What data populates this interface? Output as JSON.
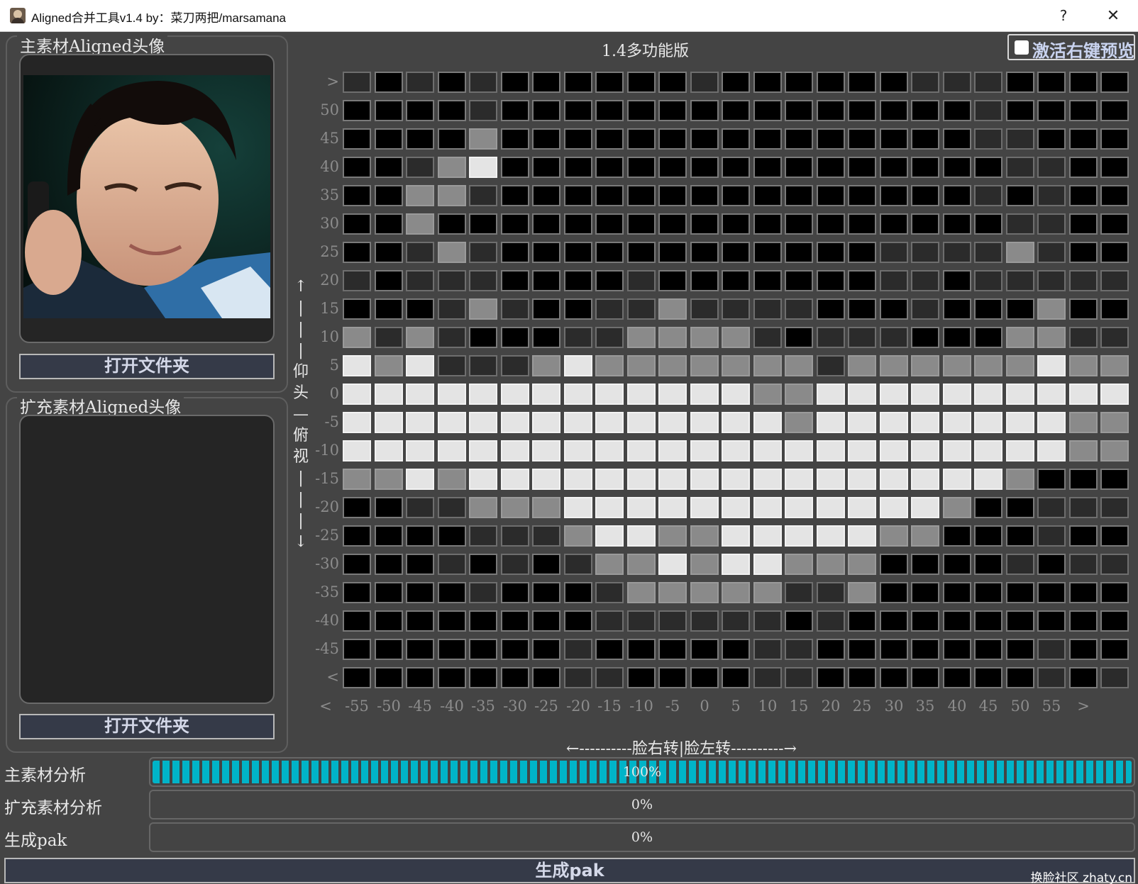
{
  "window": {
    "title": "Aligned合并工具v1.4  by：菜刀两把/marsamana",
    "help": "?",
    "close": "✕"
  },
  "main_panel": {
    "title": "主素材Aligned头像",
    "open_folder": "打开文件夹"
  },
  "ext_panel": {
    "title": "扩充素材Aligned头像",
    "open_folder": "打开文件夹"
  },
  "version": "1.4多功能版",
  "right_click_preview": {
    "label": "激活右键预览",
    "checked": false
  },
  "chart_data": {
    "type": "heatmap",
    "y_labels": [
      ">",
      "50",
      "45",
      "40",
      "35",
      "30",
      "25",
      "20",
      "15",
      "10",
      "5",
      "0",
      "-5",
      "-10",
      "-15",
      "-20",
      "-25",
      "-30",
      "-35",
      "-40",
      "-45",
      "<"
    ],
    "x_labels": [
      "<",
      "-55",
      "-50",
      "-45",
      "-40",
      "-35",
      "-30",
      "-25",
      "-20",
      "-15",
      "-10",
      "-5",
      "0",
      "5",
      "10",
      "15",
      "20",
      "25",
      "30",
      "35",
      "40",
      "45",
      "50",
      "55",
      ">"
    ],
    "levels": [
      "none",
      "few",
      "some",
      "many"
    ],
    "cells": [
      [
        1,
        0,
        1,
        0,
        1,
        0,
        0,
        0,
        0,
        0,
        0,
        1,
        0,
        0,
        0,
        0,
        0,
        0,
        1,
        1,
        1,
        0,
        0,
        0,
        0
      ],
      [
        0,
        0,
        0,
        0,
        1,
        0,
        0,
        0,
        0,
        0,
        0,
        0,
        0,
        0,
        0,
        0,
        0,
        0,
        0,
        0,
        1,
        0,
        0,
        0,
        0
      ],
      [
        0,
        0,
        0,
        0,
        2,
        0,
        0,
        0,
        0,
        0,
        0,
        0,
        0,
        0,
        0,
        0,
        0,
        0,
        0,
        0,
        1,
        1,
        0,
        0,
        0
      ],
      [
        0,
        0,
        1,
        2,
        3,
        0,
        0,
        0,
        0,
        0,
        0,
        0,
        0,
        0,
        0,
        0,
        0,
        0,
        0,
        0,
        0,
        1,
        1,
        0,
        0
      ],
      [
        0,
        0,
        2,
        2,
        1,
        0,
        0,
        0,
        0,
        0,
        0,
        0,
        0,
        0,
        0,
        0,
        0,
        0,
        0,
        0,
        1,
        0,
        1,
        0,
        0
      ],
      [
        0,
        0,
        2,
        0,
        0,
        0,
        0,
        0,
        0,
        0,
        0,
        0,
        0,
        0,
        0,
        0,
        0,
        0,
        0,
        0,
        0,
        1,
        1,
        0,
        0
      ],
      [
        0,
        0,
        1,
        2,
        1,
        0,
        0,
        0,
        0,
        0,
        0,
        0,
        0,
        0,
        0,
        0,
        0,
        1,
        1,
        1,
        1,
        2,
        1,
        0,
        0
      ],
      [
        1,
        0,
        1,
        1,
        1,
        0,
        0,
        0,
        0,
        1,
        0,
        0,
        0,
        0,
        0,
        0,
        0,
        1,
        1,
        0,
        1,
        1,
        1,
        1,
        1
      ],
      [
        0,
        0,
        0,
        1,
        2,
        1,
        0,
        0,
        1,
        1,
        2,
        1,
        1,
        1,
        1,
        0,
        0,
        0,
        1,
        0,
        0,
        0,
        2,
        0,
        0
      ],
      [
        2,
        1,
        2,
        1,
        0,
        0,
        0,
        1,
        1,
        2,
        2,
        2,
        2,
        1,
        0,
        1,
        1,
        1,
        0,
        0,
        0,
        2,
        2,
        1,
        1
      ],
      [
        3,
        2,
        3,
        1,
        1,
        1,
        2,
        3,
        2,
        2,
        2,
        2,
        2,
        2,
        2,
        1,
        2,
        2,
        2,
        2,
        2,
        2,
        3,
        2,
        2
      ],
      [
        3,
        3,
        3,
        3,
        3,
        3,
        3,
        3,
        3,
        3,
        3,
        3,
        3,
        2,
        2,
        3,
        3,
        3,
        3,
        3,
        3,
        3,
        3,
        3,
        3
      ],
      [
        3,
        3,
        3,
        3,
        3,
        3,
        3,
        3,
        3,
        3,
        3,
        3,
        3,
        3,
        2,
        3,
        3,
        3,
        3,
        3,
        3,
        3,
        3,
        2,
        2
      ],
      [
        3,
        3,
        3,
        3,
        3,
        3,
        3,
        3,
        3,
        3,
        3,
        3,
        3,
        3,
        3,
        3,
        3,
        3,
        3,
        3,
        3,
        3,
        3,
        2,
        2
      ],
      [
        2,
        2,
        3,
        2,
        3,
        3,
        3,
        3,
        3,
        3,
        3,
        3,
        3,
        3,
        3,
        3,
        3,
        3,
        3,
        3,
        3,
        2,
        0,
        0,
        0
      ],
      [
        0,
        0,
        1,
        1,
        2,
        2,
        2,
        3,
        3,
        3,
        3,
        3,
        3,
        3,
        3,
        3,
        3,
        3,
        3,
        2,
        0,
        0,
        1,
        1,
        1
      ],
      [
        0,
        0,
        0,
        0,
        1,
        1,
        1,
        2,
        3,
        3,
        2,
        2,
        3,
        3,
        3,
        3,
        3,
        2,
        2,
        0,
        0,
        0,
        1,
        0,
        0
      ],
      [
        0,
        0,
        0,
        1,
        0,
        1,
        0,
        1,
        2,
        2,
        3,
        2,
        3,
        3,
        2,
        2,
        2,
        0,
        0,
        0,
        0,
        1,
        0,
        1,
        1
      ],
      [
        0,
        0,
        0,
        0,
        1,
        0,
        0,
        0,
        1,
        2,
        2,
        2,
        2,
        2,
        1,
        1,
        2,
        0,
        0,
        0,
        0,
        0,
        0,
        0,
        0
      ],
      [
        0,
        0,
        0,
        0,
        0,
        0,
        0,
        0,
        1,
        1,
        1,
        1,
        1,
        1,
        0,
        1,
        0,
        0,
        0,
        0,
        0,
        0,
        0,
        0,
        0
      ],
      [
        0,
        0,
        0,
        0,
        0,
        0,
        0,
        1,
        0,
        0,
        0,
        0,
        0,
        1,
        1,
        0,
        0,
        0,
        0,
        0,
        0,
        0,
        1,
        0,
        0
      ],
      [
        0,
        0,
        0,
        0,
        0,
        0,
        0,
        1,
        1,
        0,
        0,
        0,
        0,
        1,
        1,
        0,
        0,
        0,
        0,
        0,
        0,
        0,
        1,
        0,
        1
      ]
    ]
  },
  "vertical_axis_label": "↑\n|\n|\n|\n仰\n头\n—\n俯\n视\n|\n|\n|\n↓",
  "horizontal_axis_label": "←----------脸右转|脸左转----------→",
  "progress": [
    {
      "label": "主素材分析",
      "value": 100,
      "text": "100%"
    },
    {
      "label": "扩充素材分析",
      "value": 0,
      "text": "0%"
    },
    {
      "label": "生成pak",
      "value": 0,
      "text": "0%"
    }
  ],
  "generate_button": "生成pak",
  "watermark": "换脸社区 zhaty.cn"
}
